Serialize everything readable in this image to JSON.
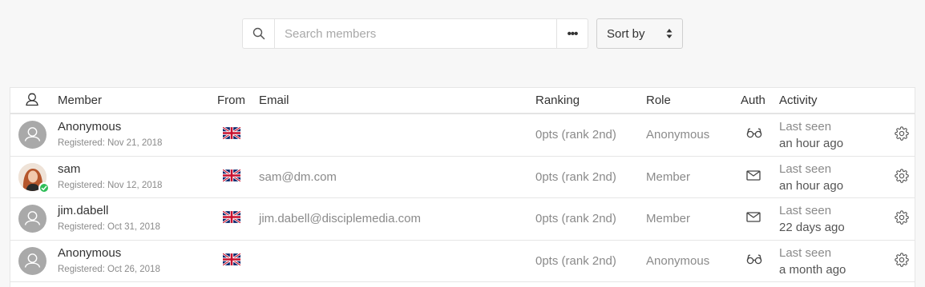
{
  "search": {
    "placeholder": "Search members",
    "more_label": "•••"
  },
  "sort": {
    "label": "Sort by"
  },
  "table": {
    "headers": {
      "member": "Member",
      "from": "From",
      "email": "Email",
      "ranking": "Ranking",
      "role": "Role",
      "auth": "Auth",
      "activity": "Activity"
    },
    "rows": [
      {
        "name": "Anonymous",
        "registered": "Registered: Nov 21, 2018",
        "flag": "uk-flag-icon",
        "email": "",
        "ranking": "0pts (rank 2nd)",
        "role": "Anonymous",
        "auth": "glasses-icon",
        "activity_label": "Last seen",
        "activity_time": "an hour ago",
        "avatar": "default-avatar",
        "online": false
      },
      {
        "name": "sam",
        "registered": "Registered: Nov 12, 2018",
        "flag": "uk-flag-icon",
        "email": "sam@dm.com",
        "ranking": "0pts (rank 2nd)",
        "role": "Member",
        "auth": "envelope-icon",
        "activity_label": "Last seen",
        "activity_time": "an hour ago",
        "avatar": "photo-avatar",
        "online": true
      },
      {
        "name": "jim.dabell",
        "registered": "Registered: Oct 31, 2018",
        "flag": "uk-flag-icon",
        "email": "jim.dabell@disciplemedia.com",
        "ranking": "0pts (rank 2nd)",
        "role": "Member",
        "auth": "envelope-icon",
        "activity_label": "Last seen",
        "activity_time": "22 days ago",
        "avatar": "default-avatar",
        "online": false
      },
      {
        "name": "Anonymous",
        "registered": "Registered: Oct 26, 2018",
        "flag": "uk-flag-icon",
        "email": "",
        "ranking": "0pts (rank 2nd)",
        "role": "Anonymous",
        "auth": "glasses-icon",
        "activity_label": "Last seen",
        "activity_time": "a month ago",
        "avatar": "default-avatar",
        "online": false
      }
    ]
  },
  "colors": {
    "online": "#2ebd57",
    "avatar_bg": "#a9a9a9",
    "muted_text": "#8a8a8a"
  }
}
